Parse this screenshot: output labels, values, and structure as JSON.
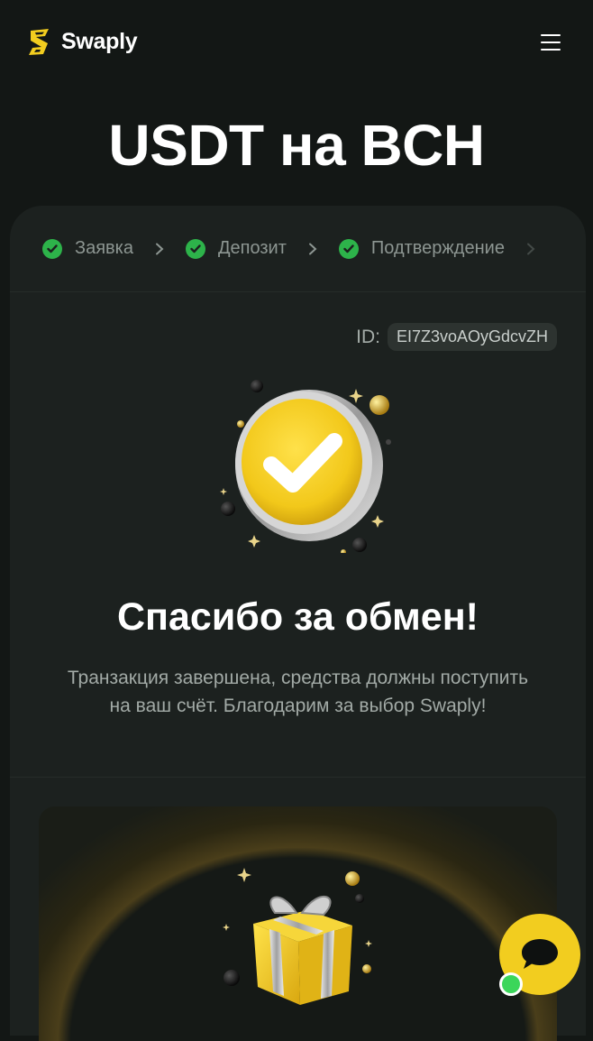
{
  "header": {
    "brand": "Swaply",
    "logo_icon": "swaply-logo-icon",
    "menu_icon": "hamburger-menu-icon"
  },
  "page": {
    "title": "USDT на BCH"
  },
  "steps": [
    {
      "label": "Заявка",
      "status": "done"
    },
    {
      "label": "Депозит",
      "status": "done"
    },
    {
      "label": "Подтверждение",
      "status": "done"
    }
  ],
  "order": {
    "id_label": "ID:",
    "id_value": "EI7Z3voAOyGdcvZH"
  },
  "result": {
    "title": "Спасибо за обмен!",
    "message": "Транзакция завершена, средства должны поступить на ваш счёт. Благодарим за выбор Swaply!",
    "icon": "gold-coin-checkmark-icon"
  },
  "promo": {
    "icon": "gift-box-icon"
  },
  "chat": {
    "icon": "chat-bubble-icon",
    "status": "online"
  },
  "colors": {
    "background": "#131715",
    "card": "#1c211f",
    "accent": "#f2cd1f",
    "success": "#2db34a",
    "muted_text": "#8d9692"
  }
}
